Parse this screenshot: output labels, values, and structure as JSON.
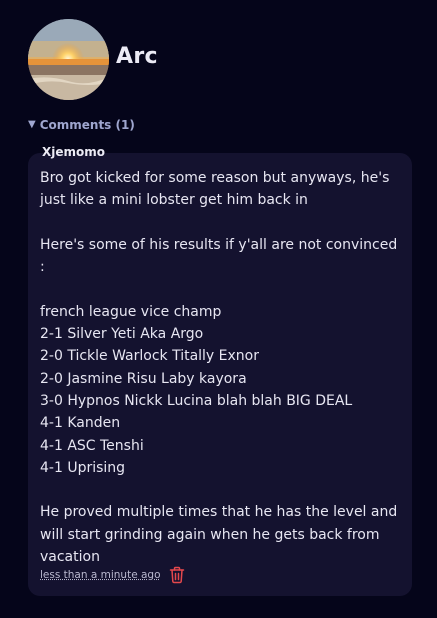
{
  "profile": {
    "name": "Arc"
  },
  "comments": {
    "toggle_arrow": "▼",
    "toggle_label": "Comments (1)",
    "items": [
      {
        "author": "Xjemomo",
        "body": "Bro got kicked for some reason but anyways, he's just like a mini lobster get him back in\n\nHere's some of his results if y'all are not convinced :\n\nfrench league vice champ\n2-1 Silver Yeti Aka Argo\n2-0 Tickle Warlock Titally Exnor\n2-0 Jasmine Risu Laby kayora\n3-0 Hypnos Nickk Lucina blah blah BIG DEAL\n4-1 Kanden\n4-1 ASC Tenshi\n4-1 Uprising\n\nHe proved multiple times that he has the level and will start grinding again when he gets back from vacation",
        "timestamp": "less than a minute ago"
      }
    ]
  },
  "icons": {
    "delete": "trash-icon",
    "avatar": "sunset-beach-photo"
  },
  "colors": {
    "background": "#05051a",
    "card": "#14122f",
    "accent_text": "#9fa6cf",
    "delete_red": "#e5484d"
  }
}
